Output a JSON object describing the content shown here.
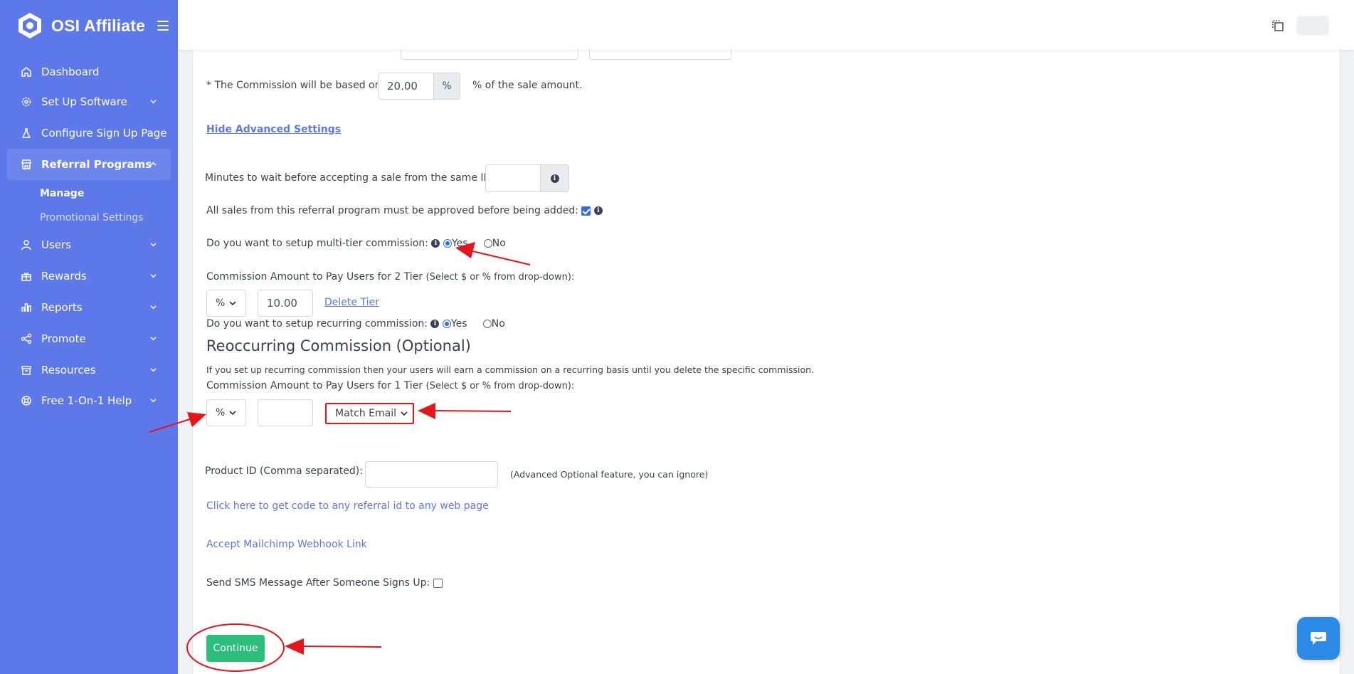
{
  "app": {
    "brand": "OSI Affiliate"
  },
  "sidebar": {
    "items": [
      {
        "label": "Dashboard",
        "icon": "home-icon"
      },
      {
        "label": "Set Up Software",
        "icon": "gear-icon",
        "expandable": true
      },
      {
        "label": "Configure Sign Up Page",
        "icon": "flask-icon"
      },
      {
        "label": "Referral Programs",
        "icon": "store-icon",
        "expandable": true,
        "active": true
      },
      {
        "label": "Users",
        "icon": "user-icon",
        "expandable": true
      },
      {
        "label": "Rewards",
        "icon": "gift-icon",
        "expandable": true
      },
      {
        "label": "Reports",
        "icon": "bar-chart-icon",
        "expandable": true
      },
      {
        "label": "Promote",
        "icon": "share-icon",
        "expandable": true
      },
      {
        "label": "Resources",
        "icon": "archive-icon",
        "expandable": true
      },
      {
        "label": "Free 1-On-1 Help",
        "icon": "lifebuoy-icon",
        "expandable": true
      }
    ],
    "subitems": [
      {
        "label": "Manage",
        "active": true
      },
      {
        "label": "Promotional Settings"
      }
    ]
  },
  "form": {
    "commission_base_label": "* The Commission will be based on",
    "commission_base_value": "20.00",
    "commission_base_addon": "%",
    "commission_base_suffix": "% of the sale amount.",
    "hide_advanced_link": "Hide Advanced Settings",
    "minutes_wait_label": "Minutes to wait before accepting a sale from the same IP:",
    "minutes_wait_value": "",
    "approve_label": "All sales from this referral program must be approved before being added:",
    "approve_checked": true,
    "multitier_label": "Do you want to setup multi-tier commission:",
    "multitier_yes": "Yes",
    "multitier_no": "No",
    "multitier_selected": "Yes",
    "tier2_label": "Commission Amount to Pay Users for 2 Tier",
    "tier2_hint": "(Select $ or % from drop-down):",
    "tier2_unit": "%",
    "tier2_value": "10.00",
    "delete_tier_link": "Delete Tier",
    "recurring_label": "Do you want to setup recurring commission:",
    "recurring_yes": "Yes",
    "recurring_no": "No",
    "recurring_selected": "Yes",
    "reoccurring_heading": "Reoccurring Commission (Optional)",
    "reoccurring_desc": "If you set up recurring commission then your users will earn a commission on a recurring basis until you delete the specific commission.",
    "tier1_label": "Commission Amount to Pay Users for 1 Tier",
    "tier1_hint": "(Select $ or % from drop-down):",
    "tier1_unit": "%",
    "tier1_value": "",
    "match_select": "Match Email",
    "product_id_label": "Product ID (Comma separated):",
    "product_id_value": "",
    "product_id_note": "(Advanced Optional feature, you can ignore)",
    "code_link": "Click here to get code to any referral id to any web page",
    "mailchimp_link": "Accept Mailchimp Webhook Link",
    "sms_label": "Send SMS Message After Someone Signs Up:",
    "sms_checked": false,
    "continue_button": "Continue"
  },
  "colors": {
    "sidebar": "#5c78e9",
    "accent_link": "#5c78e9",
    "continue_button": "#2cbf7b",
    "annotation": "#e8141c",
    "chat_button": "#2b8ae8"
  }
}
